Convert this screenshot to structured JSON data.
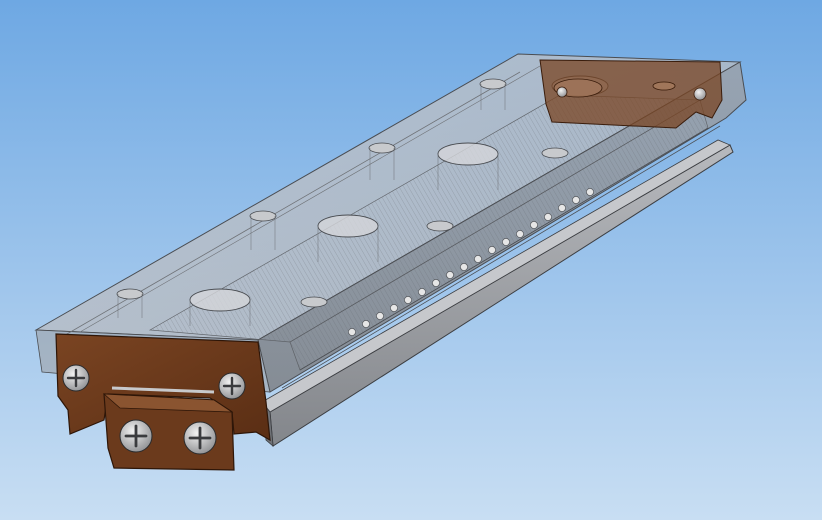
{
  "scene": {
    "subject": "linear-guide-carriage-3d-model",
    "background_top": "#6aa6e2",
    "background_bottom": "#c4ddf3",
    "housing_color": "#b9bcc2",
    "rail_color": "#8f9398",
    "end_plate_color": "#6b3a1c",
    "ball_color": "#e2e2e2",
    "screw_icon": "phillips-screw-icon"
  }
}
